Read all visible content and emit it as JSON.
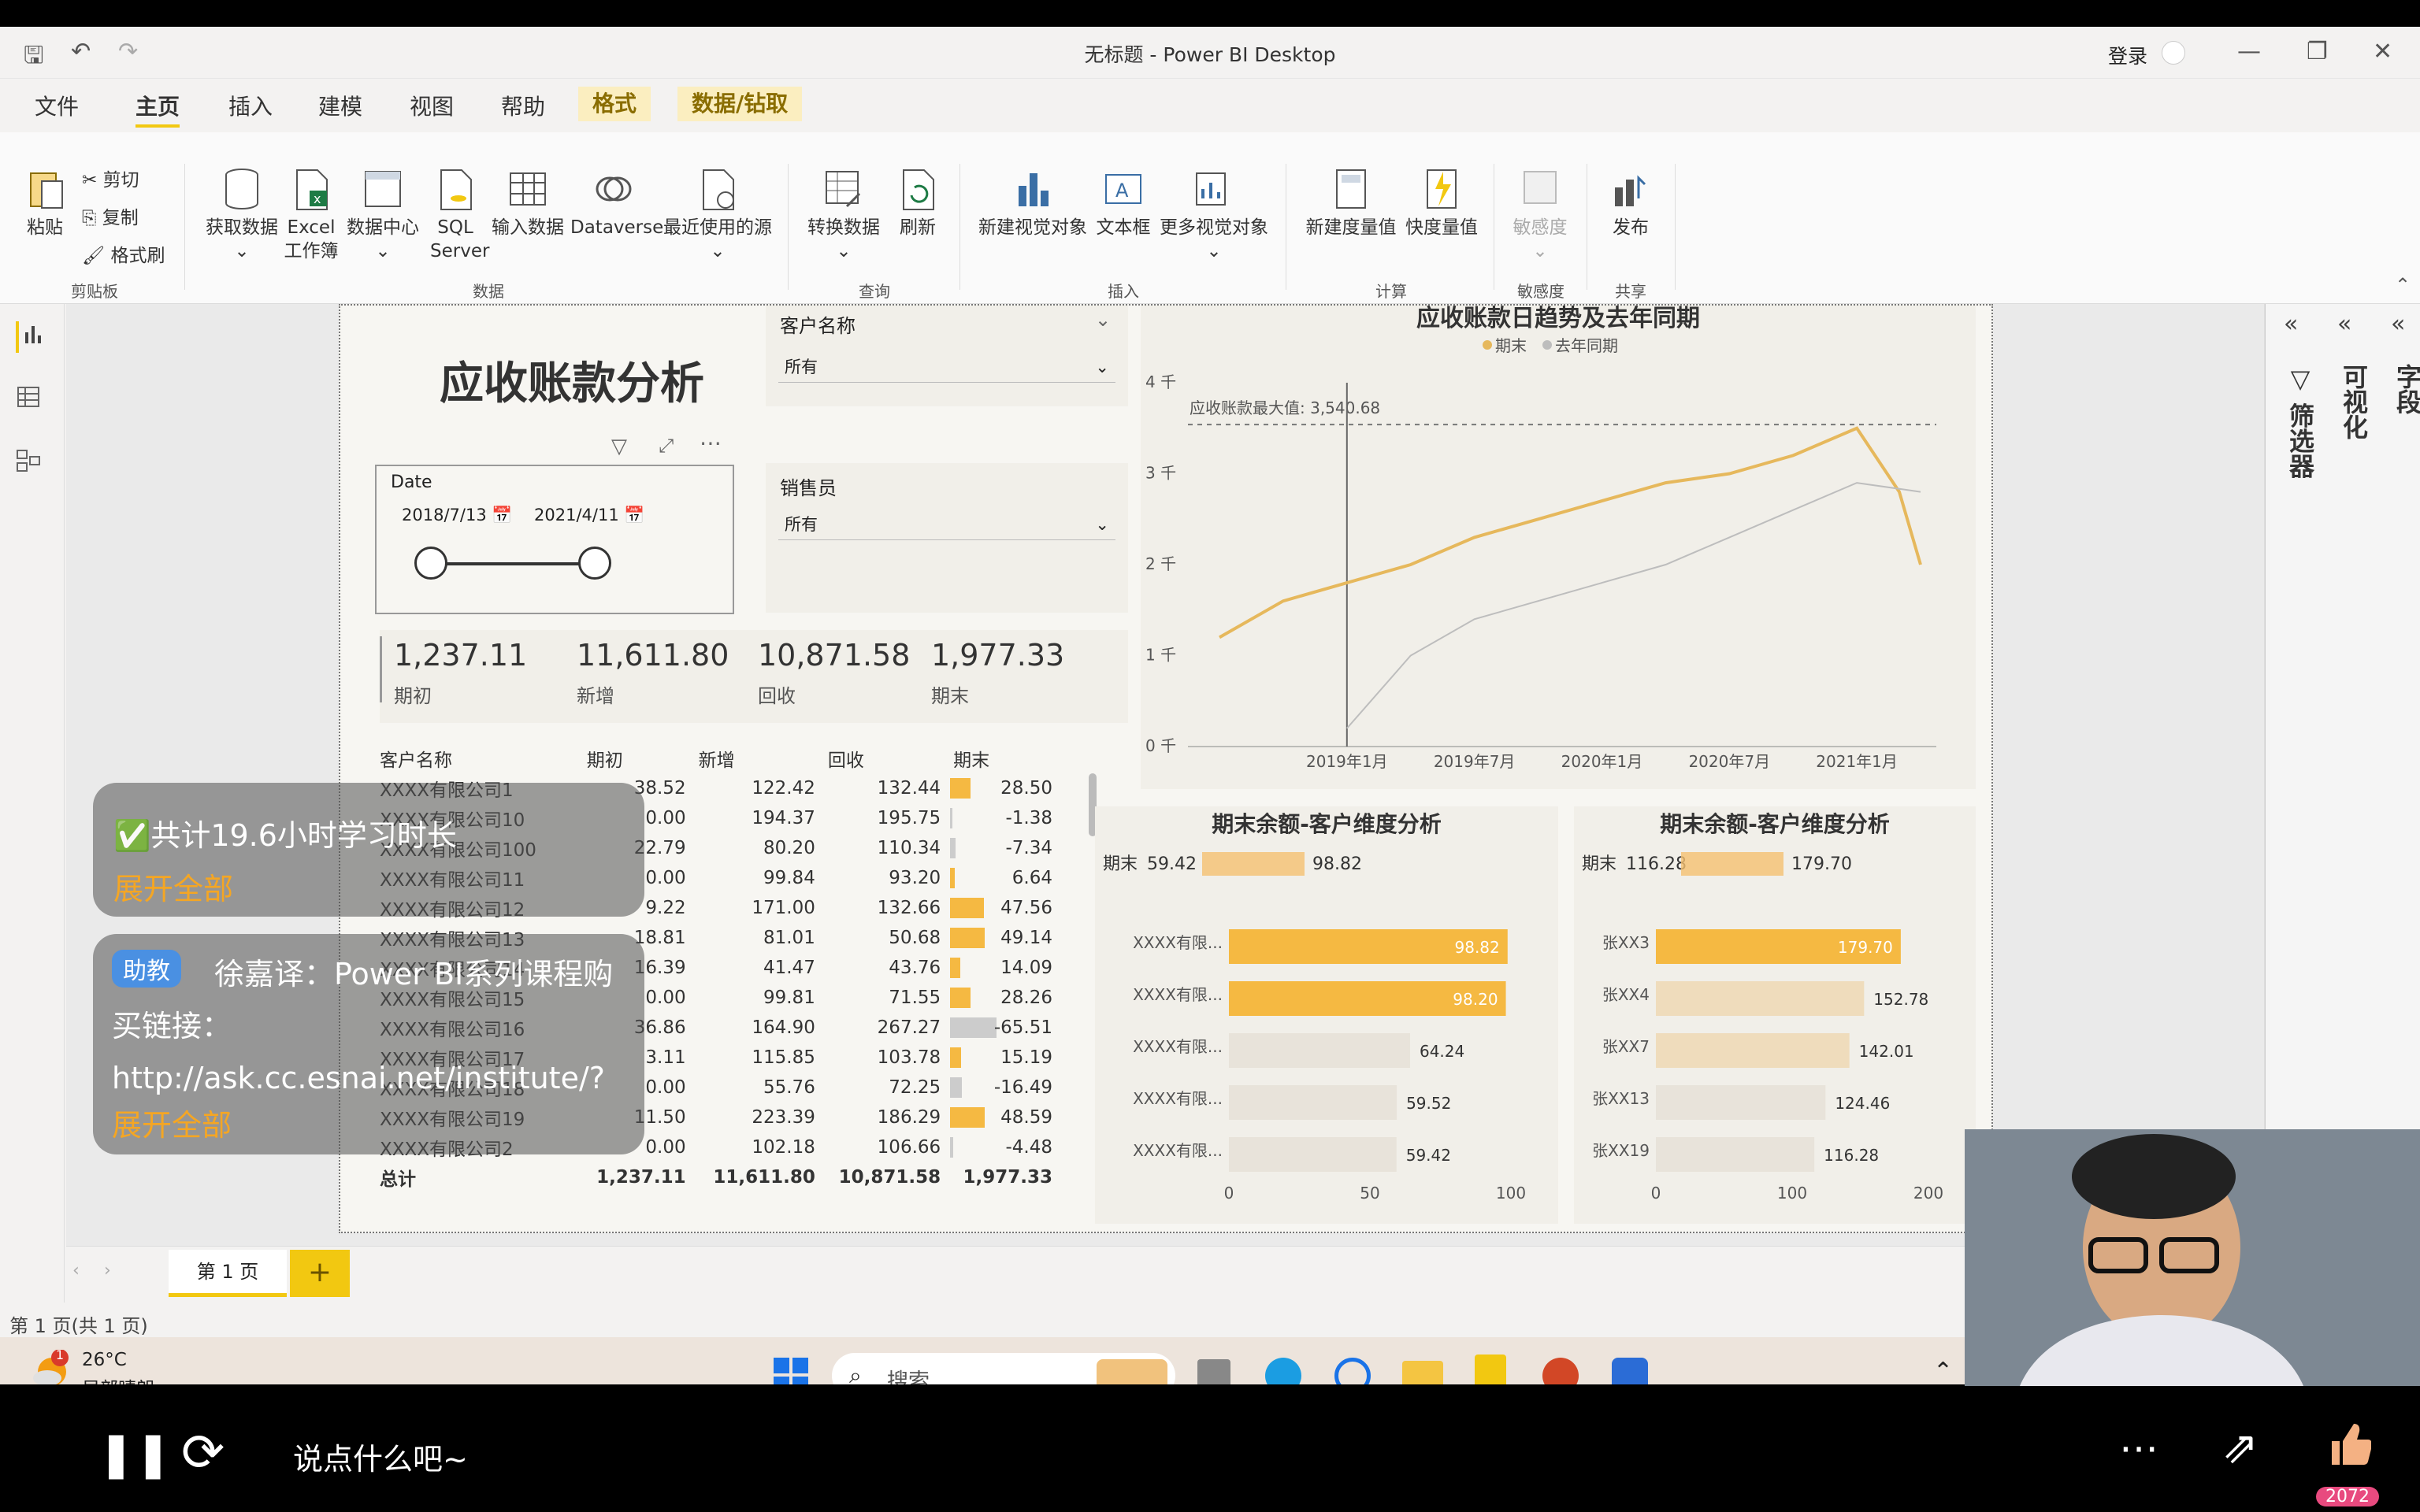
{
  "window": {
    "title": "无标题 - Power BI Desktop",
    "login": "登录"
  },
  "menu": [
    "文件",
    "主页",
    "插入",
    "建模",
    "视图",
    "帮助",
    "格式",
    "数据/钻取"
  ],
  "ribbon": {
    "clipboard": {
      "paste": "粘贴",
      "cut": "剪切",
      "copy": "复制",
      "format_painter": "格式刷",
      "group": "剪贴板"
    },
    "data": {
      "get_data": "获取数据",
      "excel": "Excel",
      "excel2": "工作簿",
      "hub": "数据中心",
      "sql": "SQL",
      "sql2": "Server",
      "enter": "输入数据",
      "dataverse": "Dataverse",
      "recent": "最近使用的源",
      "group": "数据"
    },
    "query": {
      "transform": "转换数据",
      "refresh": "刷新",
      "group": "查询"
    },
    "insert": {
      "new_visual": "新建视觉对象",
      "textbox": "文本框",
      "more": "更多视觉对象",
      "group": "插入"
    },
    "calc": {
      "new_measure": "新建度量值",
      "quick_measure": "快度量值",
      "group": "计算"
    },
    "sensitivity": {
      "label": "敏感度",
      "group": "敏感度"
    },
    "share": {
      "publish": "发布",
      "group": "共享"
    }
  },
  "panes": {
    "fields": "字段",
    "visualizations": "可视化",
    "filters": "筛选器"
  },
  "report": {
    "title": "应收账款分析",
    "date_slicer": {
      "label": "Date",
      "start": "2018/7/13",
      "end": "2021/4/11"
    },
    "slicer_customer": {
      "label": "客户名称",
      "value": "所有"
    },
    "slicer_sales": {
      "label": "销售员",
      "value": "所有"
    },
    "kpis": [
      {
        "value": "1,237.11",
        "label": "期初"
      },
      {
        "value": "11,611.80",
        "label": "新增"
      },
      {
        "value": "10,871.58",
        "label": "回收"
      },
      {
        "value": "1,977.33",
        "label": "期末"
      }
    ],
    "table": {
      "headers": [
        "客户名称",
        "期初",
        "新增",
        "回收",
        "期末"
      ],
      "rows": [
        [
          "XXXX有限公司1",
          "38.52",
          "122.42",
          "132.44",
          "28.50"
        ],
        [
          "XXXX有限公司10",
          "0.00",
          "194.37",
          "195.75",
          "-1.38"
        ],
        [
          "XXXX有限公司100",
          "22.79",
          "80.20",
          "110.34",
          "-7.34"
        ],
        [
          "XXXX有限公司11",
          "0.00",
          "99.84",
          "93.20",
          "6.64"
        ],
        [
          "XXXX有限公司12",
          "9.22",
          "171.00",
          "132.66",
          "47.56"
        ],
        [
          "XXXX有限公司13",
          "18.81",
          "81.01",
          "50.68",
          "49.14"
        ],
        [
          "XXXX有限公司14",
          "16.39",
          "41.47",
          "43.76",
          "14.09"
        ],
        [
          "XXXX有限公司15",
          "0.00",
          "99.81",
          "71.55",
          "28.26"
        ],
        [
          "XXXX有限公司16",
          "36.86",
          "164.90",
          "267.27",
          "-65.51"
        ],
        [
          "XXXX有限公司17",
          "3.11",
          "115.85",
          "103.78",
          "15.19"
        ],
        [
          "XXXX有限公司18",
          "0.00",
          "55.76",
          "72.25",
          "-16.49"
        ],
        [
          "XXXX有限公司19",
          "11.50",
          "223.39",
          "186.29",
          "48.59"
        ],
        [
          "XXXX有限公司2",
          "0.00",
          "102.18",
          "106.66",
          "-4.48"
        ]
      ],
      "total": [
        "总计",
        "1,237.11",
        "11,611.80",
        "10,871.58",
        "1,977.33"
      ]
    }
  },
  "chart_data": [
    {
      "type": "line",
      "title": "应收账款日趋势及去年同期",
      "series": [
        {
          "name": "期末",
          "color": "#e6b85c",
          "x": [
            "2018-07",
            "2018-10",
            "2019-01",
            "2019-04",
            "2019-07",
            "2019-10",
            "2020-01",
            "2020-04",
            "2020-07",
            "2020-10",
            "2021-01",
            "2021-03",
            "2021-04"
          ],
          "values": [
            1.2,
            1.6,
            1.8,
            2.0,
            2.3,
            2.5,
            2.7,
            2.9,
            3.0,
            3.2,
            3.5,
            2.8,
            2.0
          ]
        },
        {
          "name": "去年同期",
          "color": "#bdbdbd",
          "x": [
            "2019-01",
            "2019-04",
            "2019-07",
            "2019-10",
            "2020-01",
            "2020-04",
            "2020-07",
            "2020-10",
            "2021-01",
            "2021-04"
          ],
          "values": [
            0.2,
            1.0,
            1.4,
            1.6,
            1.8,
            2.0,
            2.3,
            2.6,
            2.9,
            2.8
          ]
        }
      ],
      "yticks": [
        "0 千",
        "1 千",
        "2 千",
        "3 千",
        "4 千"
      ],
      "ylim": [
        0,
        4
      ],
      "xticks": [
        "2019年1月",
        "2019年7月",
        "2020年1月",
        "2020年7月",
        "2021年1月"
      ],
      "annotation": "应收账款最大值: 3,540.68",
      "max_line": 3.54
    },
    {
      "type": "bar",
      "title": "期末余额-客户维度分析",
      "legend_label": "期末",
      "legend_min": "59.42",
      "legend_max": "98.82",
      "categories": [
        "XXXX有限...",
        "XXXX有限...",
        "XXXX有限...",
        "XXXX有限...",
        "XXXX有限..."
      ],
      "values": [
        98.82,
        98.2,
        64.24,
        59.52,
        59.42
      ],
      "xticks": [
        "0",
        "50",
        "100"
      ],
      "xlim": [
        0,
        100
      ]
    },
    {
      "type": "bar",
      "title": "期末余额-客户维度分析",
      "legend_label": "期末",
      "legend_min": "116.28",
      "legend_max": "179.70",
      "categories": [
        "张XX3",
        "张XX4",
        "张XX7",
        "张XX13",
        "张XX19"
      ],
      "values": [
        179.7,
        152.78,
        142.01,
        124.46,
        116.28
      ],
      "xticks": [
        "0",
        "100",
        "200"
      ],
      "xlim": [
        0,
        200
      ]
    }
  ],
  "pages": {
    "tab": "第 1 页",
    "status": "第 1 页(共 1 页)"
  },
  "overlay": {
    "line1": "✅共计19.6小时学习时长",
    "expand": "展开全部",
    "tag": "助教",
    "msg": "徐嘉译：Power BI系列课程购买链接：http://ask.cc.esnai.net/institute/?coursecode=Powe...",
    "expand2": "展开全部"
  },
  "taskbar": {
    "weather_temp": "26°C",
    "weather_desc": "局部晴朗",
    "search": "搜索",
    "badge": "1"
  },
  "video": {
    "comment": "说点什么吧~",
    "likes": "2072"
  }
}
